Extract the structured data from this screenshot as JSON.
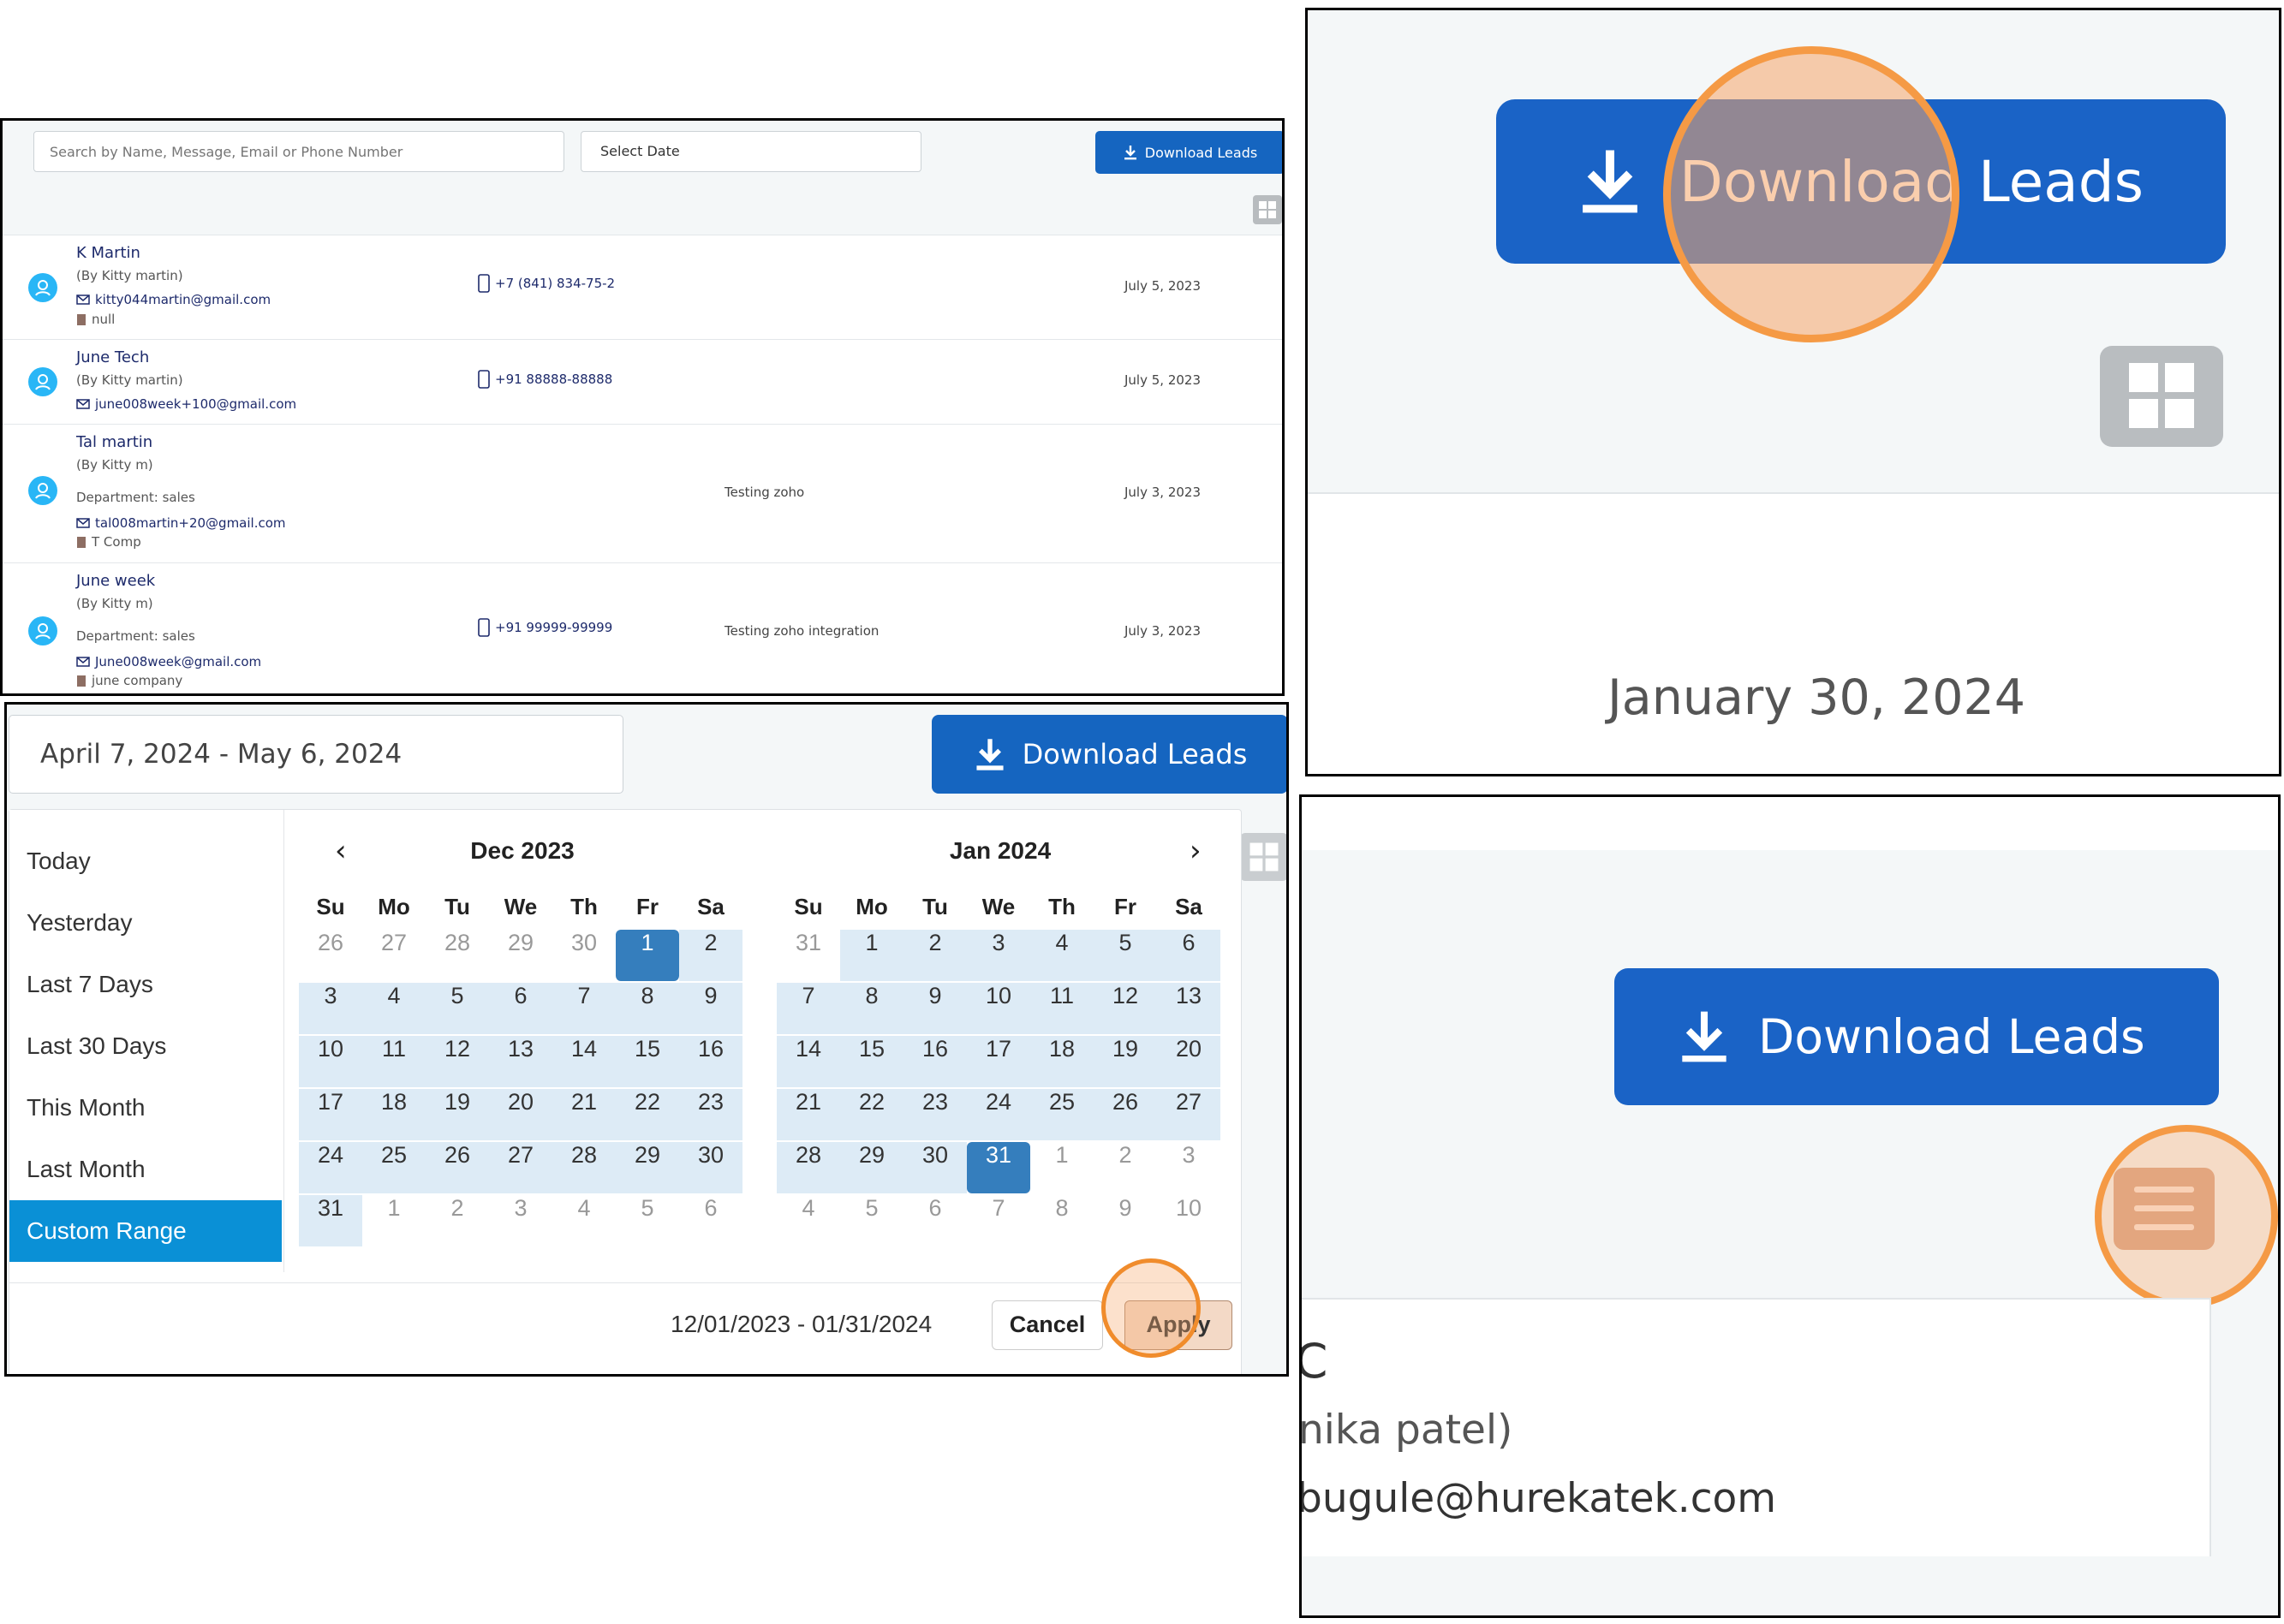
{
  "leads_panel": {
    "search_placeholder": "Search by Name, Message, Email or Phone Number",
    "date_placeholder": "Select Date",
    "download_label": "Download Leads",
    "leads": [
      {
        "name": "K Martin",
        "by": "(By Kitty martin)",
        "department": "",
        "email": "kitty044martin@gmail.com",
        "company": "null",
        "phone": "+7 (841) 834-75-2",
        "message": "",
        "date": "July 5, 2023"
      },
      {
        "name": "June Tech",
        "by": "(By Kitty martin)",
        "department": "",
        "email": "june008week+100@gmail.com",
        "company": "",
        "phone": "+91 88888-88888",
        "message": "",
        "date": "July 5, 2023"
      },
      {
        "name": "Tal martin",
        "by": "(By Kitty m)",
        "department": "Department: sales",
        "email": "tal008martin+20@gmail.com",
        "company": "T Comp",
        "phone": "",
        "message": "Testing zoho",
        "date": "July 3, 2023"
      },
      {
        "name": "June week",
        "by": "(By Kitty m)",
        "department": "Department: sales",
        "email": "June008week@gmail.com",
        "company": "june company",
        "phone": "+91 99999-99999",
        "message": "Testing zoho integration",
        "date": "July 3, 2023"
      }
    ]
  },
  "picker_panel": {
    "range_value": "April 7, 2024 - May 6, 2024",
    "download_label": "Download Leads",
    "ranges": [
      "Today",
      "Yesterday",
      "Last 7 Days",
      "Last 30 Days",
      "This Month",
      "Last Month",
      "Custom Range"
    ],
    "active_range": "Custom Range",
    "weekdays": [
      "Su",
      "Mo",
      "Tu",
      "We",
      "Th",
      "Fr",
      "Sa"
    ],
    "left_calendar": {
      "title": "Dec 2023",
      "days": [
        "26",
        "27",
        "28",
        "29",
        "30",
        "1",
        "2",
        "3",
        "4",
        "5",
        "6",
        "7",
        "8",
        "9",
        "10",
        "11",
        "12",
        "13",
        "14",
        "15",
        "16",
        "17",
        "18",
        "19",
        "20",
        "21",
        "22",
        "23",
        "24",
        "25",
        "26",
        "27",
        "28",
        "29",
        "30",
        "31",
        "1",
        "2",
        "3",
        "4",
        "5",
        "6"
      ],
      "first_in_month": 5,
      "last_in_month": 35,
      "selected": 5
    },
    "right_calendar": {
      "title": "Jan 2024",
      "days": [
        "31",
        "1",
        "2",
        "3",
        "4",
        "5",
        "6",
        "7",
        "8",
        "9",
        "10",
        "11",
        "12",
        "13",
        "14",
        "15",
        "16",
        "17",
        "18",
        "19",
        "20",
        "21",
        "22",
        "23",
        "24",
        "25",
        "26",
        "27",
        "28",
        "29",
        "30",
        "31",
        "1",
        "2",
        "3",
        "4",
        "5",
        "6",
        "7",
        "8",
        "9",
        "10"
      ],
      "first_in_month": 1,
      "last_in_month": 31,
      "selected": 31
    },
    "selected_range_label": "12/01/2023 - 01/31/2024",
    "cancel_label": "Cancel",
    "apply_label": "Apply"
  },
  "zoom_download_panel": {
    "button_label": "Download Leads",
    "date_text": "January 30, 2024"
  },
  "zoom_menu_panel": {
    "button_label": "Download Leads",
    "card_line1": "C",
    "card_line2": "nika patel)",
    "card_line3": "bugule@hurekatek.com"
  },
  "colors": {
    "primary": "#1565c0",
    "avatar": "#29b6f6",
    "highlight_ring": "#f08c2c",
    "range_active": "#0a90d6",
    "day_selected": "#357ebd"
  }
}
